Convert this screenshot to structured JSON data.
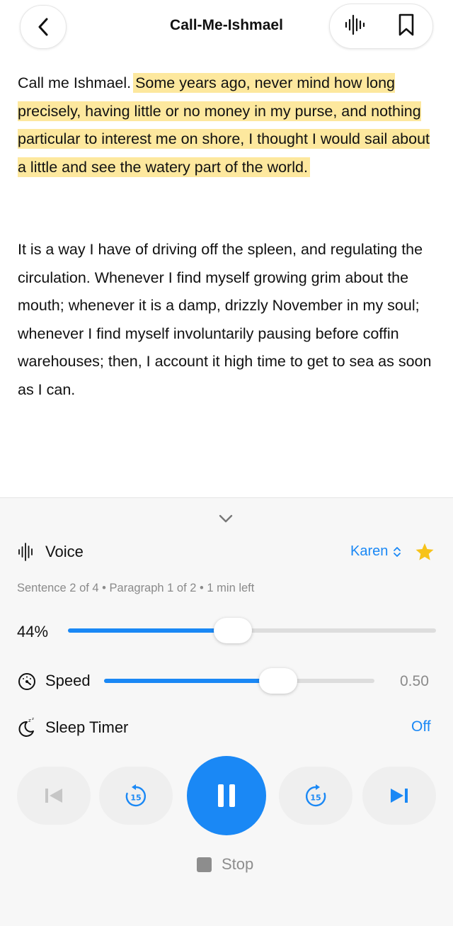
{
  "header": {
    "title": "Call-Me-Ishmael",
    "back_icon": "chevron-left-icon",
    "waveform_icon": "audio-waveform-icon",
    "bookmark_icon": "bookmark-icon"
  },
  "text": {
    "para1_plain": "Call me Ishmael.",
    "para1_highlighted": "Some years ago, never mind how long precisely, having little or no money in my purse, and nothing particular to interest me on shore, I thought I would sail about a little and see the watery part of the world.",
    "para2": "It is a way I have of driving off the spleen, and regulating the circulation. Whenever I find myself growing grim about the mouth; whenever it is a damp, drizzly November in my soul; whenever I find myself involuntarily pausing before coffin warehouses; then, I account it high time to get to sea as soon as I can."
  },
  "player": {
    "collapse_icon": "chevron-down-icon",
    "voice": {
      "label": "Voice",
      "value": "Karen",
      "favorite_icon": "star-icon"
    },
    "status": "Sentence 2 of 4 • Paragraph 1 of 2 • 1 min left",
    "progress": {
      "label": "44%",
      "value": 0.44
    },
    "speed": {
      "label": "Speed",
      "value": "0.50",
      "fraction": 0.52
    },
    "sleep_timer": {
      "label": "Sleep Timer",
      "value": "Off"
    },
    "controls": {
      "skip_back_seconds": "15",
      "skip_forward_seconds": "15"
    },
    "stop_label": "Stop"
  },
  "colors": {
    "accent": "#1a88f5",
    "highlight": "#fde89e",
    "star": "#f7c31a"
  }
}
